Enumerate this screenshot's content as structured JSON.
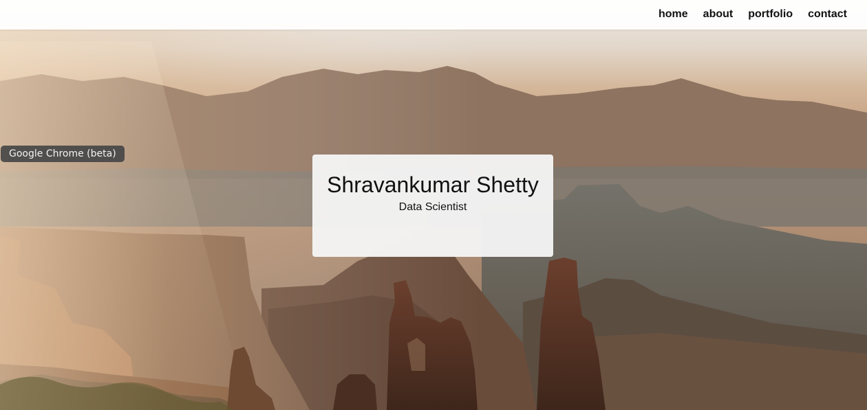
{
  "nav": {
    "items": [
      {
        "label": "home"
      },
      {
        "label": "about"
      },
      {
        "label": "portfolio"
      },
      {
        "label": "contact"
      }
    ]
  },
  "hero": {
    "name": "Shravankumar Shetty",
    "role": "Data Scientist"
  },
  "tooltip": {
    "text": "Google Chrome (beta)"
  },
  "background": {
    "description_icon": "canyon-landscape-photo"
  }
}
